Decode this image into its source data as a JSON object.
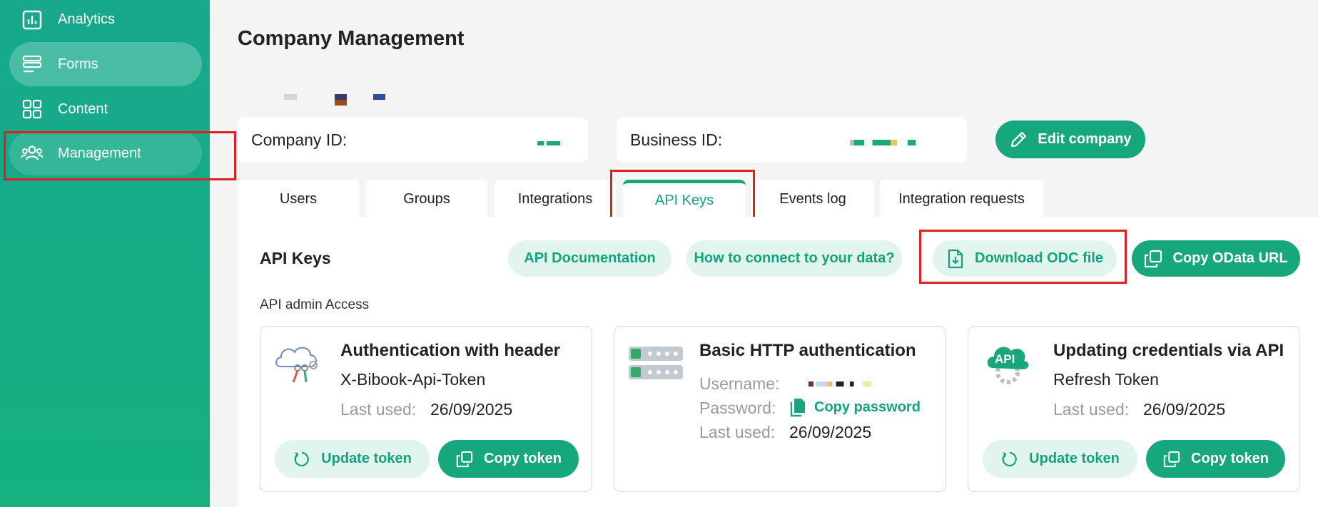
{
  "sidebar": {
    "items": [
      {
        "label": "Analytics",
        "icon": "chart-bar-icon"
      },
      {
        "label": "Forms",
        "icon": "forms-list-icon"
      },
      {
        "label": "Content",
        "icon": "grid-icon"
      },
      {
        "label": "Management",
        "icon": "users-icon"
      }
    ]
  },
  "header": {
    "title": "Company Management"
  },
  "company": {
    "company_id_label": "Company ID:",
    "business_id_label": "Business ID:",
    "edit_label": "Edit company"
  },
  "tabs": [
    "Users",
    "Groups",
    "Integrations",
    "API Keys",
    "Events log",
    "Integration requests"
  ],
  "api": {
    "section_title": "API Keys",
    "doc_label": "API Documentation",
    "connect_label": "How to connect to your data?",
    "odc_label": "Download ODC file",
    "odata_label": "Copy OData URL",
    "admin_access_label": "API admin Access"
  },
  "cards": {
    "header_auth": {
      "title": "Authentication with header",
      "token_name": "X-Bibook-Api-Token",
      "last_used_label": "Last used:",
      "last_used_value": "26/09/2025",
      "update_label": "Update token",
      "copy_label": "Copy token"
    },
    "basic_auth": {
      "title": "Basic HTTP authentication",
      "username_label": "Username:",
      "password_label": "Password:",
      "copy_password_label": "Copy password",
      "last_used_label": "Last used:",
      "last_used_value": "26/09/2025"
    },
    "refresh": {
      "title": "Updating credentials via API",
      "token_name": "Refresh Token",
      "last_used_label": "Last used:",
      "last_used_value": "26/09/2025",
      "update_label": "Update token",
      "copy_label": "Copy token",
      "badge": "API"
    }
  },
  "colors": {
    "accent": "#16a77c",
    "accent_soft": "#e1f4ee",
    "highlight": "#e02020"
  }
}
